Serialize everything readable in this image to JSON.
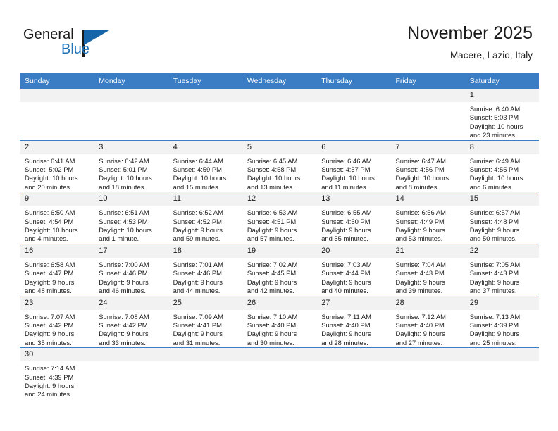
{
  "logo": {
    "word_top": "General",
    "word_bottom": "Blue",
    "accent_color": "#1565a8"
  },
  "header": {
    "title": "November 2025",
    "subtitle": "Macere, Lazio, Italy",
    "header_bg": "#3b7dc4"
  },
  "weekday_headers": [
    "Sunday",
    "Monday",
    "Tuesday",
    "Wednesday",
    "Thursday",
    "Friday",
    "Saturday"
  ],
  "weeks": [
    [
      {
        "day": "",
        "lines": []
      },
      {
        "day": "",
        "lines": []
      },
      {
        "day": "",
        "lines": []
      },
      {
        "day": "",
        "lines": []
      },
      {
        "day": "",
        "lines": []
      },
      {
        "day": "",
        "lines": []
      },
      {
        "day": "1",
        "lines": [
          "Sunrise: 6:40 AM",
          "Sunset: 5:03 PM",
          "Daylight: 10 hours",
          "and 23 minutes."
        ]
      }
    ],
    [
      {
        "day": "2",
        "lines": [
          "Sunrise: 6:41 AM",
          "Sunset: 5:02 PM",
          "Daylight: 10 hours",
          "and 20 minutes."
        ]
      },
      {
        "day": "3",
        "lines": [
          "Sunrise: 6:42 AM",
          "Sunset: 5:01 PM",
          "Daylight: 10 hours",
          "and 18 minutes."
        ]
      },
      {
        "day": "4",
        "lines": [
          "Sunrise: 6:44 AM",
          "Sunset: 4:59 PM",
          "Daylight: 10 hours",
          "and 15 minutes."
        ]
      },
      {
        "day": "5",
        "lines": [
          "Sunrise: 6:45 AM",
          "Sunset: 4:58 PM",
          "Daylight: 10 hours",
          "and 13 minutes."
        ]
      },
      {
        "day": "6",
        "lines": [
          "Sunrise: 6:46 AM",
          "Sunset: 4:57 PM",
          "Daylight: 10 hours",
          "and 11 minutes."
        ]
      },
      {
        "day": "7",
        "lines": [
          "Sunrise: 6:47 AM",
          "Sunset: 4:56 PM",
          "Daylight: 10 hours",
          "and 8 minutes."
        ]
      },
      {
        "day": "8",
        "lines": [
          "Sunrise: 6:49 AM",
          "Sunset: 4:55 PM",
          "Daylight: 10 hours",
          "and 6 minutes."
        ]
      }
    ],
    [
      {
        "day": "9",
        "lines": [
          "Sunrise: 6:50 AM",
          "Sunset: 4:54 PM",
          "Daylight: 10 hours",
          "and 4 minutes."
        ]
      },
      {
        "day": "10",
        "lines": [
          "Sunrise: 6:51 AM",
          "Sunset: 4:53 PM",
          "Daylight: 10 hours",
          "and 1 minute."
        ]
      },
      {
        "day": "11",
        "lines": [
          "Sunrise: 6:52 AM",
          "Sunset: 4:52 PM",
          "Daylight: 9 hours",
          "and 59 minutes."
        ]
      },
      {
        "day": "12",
        "lines": [
          "Sunrise: 6:53 AM",
          "Sunset: 4:51 PM",
          "Daylight: 9 hours",
          "and 57 minutes."
        ]
      },
      {
        "day": "13",
        "lines": [
          "Sunrise: 6:55 AM",
          "Sunset: 4:50 PM",
          "Daylight: 9 hours",
          "and 55 minutes."
        ]
      },
      {
        "day": "14",
        "lines": [
          "Sunrise: 6:56 AM",
          "Sunset: 4:49 PM",
          "Daylight: 9 hours",
          "and 53 minutes."
        ]
      },
      {
        "day": "15",
        "lines": [
          "Sunrise: 6:57 AM",
          "Sunset: 4:48 PM",
          "Daylight: 9 hours",
          "and 50 minutes."
        ]
      }
    ],
    [
      {
        "day": "16",
        "lines": [
          "Sunrise: 6:58 AM",
          "Sunset: 4:47 PM",
          "Daylight: 9 hours",
          "and 48 minutes."
        ]
      },
      {
        "day": "17",
        "lines": [
          "Sunrise: 7:00 AM",
          "Sunset: 4:46 PM",
          "Daylight: 9 hours",
          "and 46 minutes."
        ]
      },
      {
        "day": "18",
        "lines": [
          "Sunrise: 7:01 AM",
          "Sunset: 4:46 PM",
          "Daylight: 9 hours",
          "and 44 minutes."
        ]
      },
      {
        "day": "19",
        "lines": [
          "Sunrise: 7:02 AM",
          "Sunset: 4:45 PM",
          "Daylight: 9 hours",
          "and 42 minutes."
        ]
      },
      {
        "day": "20",
        "lines": [
          "Sunrise: 7:03 AM",
          "Sunset: 4:44 PM",
          "Daylight: 9 hours",
          "and 40 minutes."
        ]
      },
      {
        "day": "21",
        "lines": [
          "Sunrise: 7:04 AM",
          "Sunset: 4:43 PM",
          "Daylight: 9 hours",
          "and 39 minutes."
        ]
      },
      {
        "day": "22",
        "lines": [
          "Sunrise: 7:05 AM",
          "Sunset: 4:43 PM",
          "Daylight: 9 hours",
          "and 37 minutes."
        ]
      }
    ],
    [
      {
        "day": "23",
        "lines": [
          "Sunrise: 7:07 AM",
          "Sunset: 4:42 PM",
          "Daylight: 9 hours",
          "and 35 minutes."
        ]
      },
      {
        "day": "24",
        "lines": [
          "Sunrise: 7:08 AM",
          "Sunset: 4:42 PM",
          "Daylight: 9 hours",
          "and 33 minutes."
        ]
      },
      {
        "day": "25",
        "lines": [
          "Sunrise: 7:09 AM",
          "Sunset: 4:41 PM",
          "Daylight: 9 hours",
          "and 31 minutes."
        ]
      },
      {
        "day": "26",
        "lines": [
          "Sunrise: 7:10 AM",
          "Sunset: 4:40 PM",
          "Daylight: 9 hours",
          "and 30 minutes."
        ]
      },
      {
        "day": "27",
        "lines": [
          "Sunrise: 7:11 AM",
          "Sunset: 4:40 PM",
          "Daylight: 9 hours",
          "and 28 minutes."
        ]
      },
      {
        "day": "28",
        "lines": [
          "Sunrise: 7:12 AM",
          "Sunset: 4:40 PM",
          "Daylight: 9 hours",
          "and 27 minutes."
        ]
      },
      {
        "day": "29",
        "lines": [
          "Sunrise: 7:13 AM",
          "Sunset: 4:39 PM",
          "Daylight: 9 hours",
          "and 25 minutes."
        ]
      }
    ],
    [
      {
        "day": "30",
        "lines": [
          "Sunrise: 7:14 AM",
          "Sunset: 4:39 PM",
          "Daylight: 9 hours",
          "and 24 minutes."
        ]
      },
      {
        "day": "",
        "lines": []
      },
      {
        "day": "",
        "lines": []
      },
      {
        "day": "",
        "lines": []
      },
      {
        "day": "",
        "lines": []
      },
      {
        "day": "",
        "lines": []
      },
      {
        "day": "",
        "lines": []
      }
    ]
  ]
}
